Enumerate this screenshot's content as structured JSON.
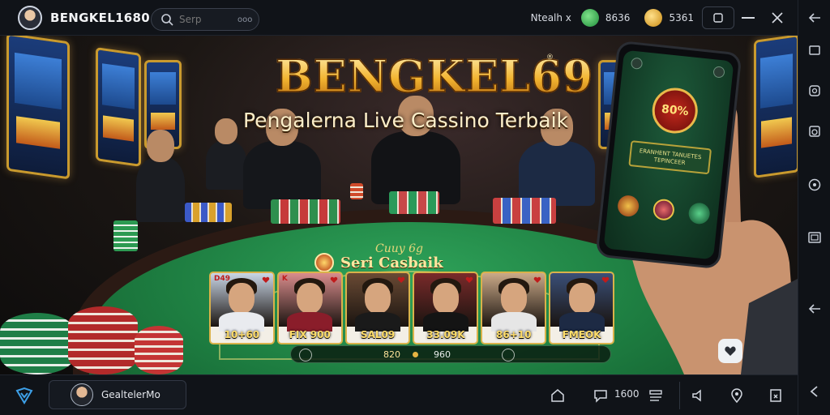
{
  "app": {
    "title": "BENGKEL1680"
  },
  "search": {
    "placeholder": "Serp",
    "badge": "ooo"
  },
  "topbar": {
    "status_label": "Ntealh x",
    "balance_green": "8636",
    "balance_gold": "5361"
  },
  "hero": {
    "brand": "BENGKEL69",
    "trademark": "®",
    "tagline": "Pengalerna Live Cassino Terbaik"
  },
  "table": {
    "felt_logo": "Cuuy 6g",
    "banner": "Seri Casbaik",
    "bet_amount": "820",
    "bet_balance": "960"
  },
  "dealer_cards": [
    {
      "corner": "D49",
      "value": "10+60",
      "shirt": "#e9ebef",
      "bg": "#c9d6e6"
    },
    {
      "corner": "K",
      "value": "FIX 900",
      "shirt": "#8a1d2a",
      "bg": "#d98c8c"
    },
    {
      "corner": "",
      "value": "SAL09",
      "shirt": "#1a1a1a",
      "bg": "#6a4a34"
    },
    {
      "corner": "",
      "value": "33.09K",
      "shirt": "#141414",
      "bg": "#7a2a2a"
    },
    {
      "corner": "",
      "value": "86+10",
      "shirt": "#e6e6e6",
      "bg": "#caa988"
    },
    {
      "corner": "",
      "value": "FMEOK",
      "shirt": "#1d2a44",
      "bg": "#3a4f78"
    }
  ],
  "phone": {
    "badge": "80%",
    "box_text": "ERANHENT TANUETES TEPINCEER"
  },
  "bottombar": {
    "username": "GealtelerMo",
    "counter": "1600"
  },
  "icons": {
    "top": [
      "search-icon",
      "minimize-icon",
      "close-icon"
    ],
    "rail": [
      "back-arrow-icon",
      "square-icon",
      "screenshot-icon",
      "settings-icon",
      "keyboard-icon",
      "fullscreen-icon",
      "back-arrow-icon"
    ],
    "bottom": [
      "app-logo-icon",
      "home-icon",
      "chat-icon",
      "menu-icon",
      "volume-icon",
      "location-icon",
      "exit-icon",
      "collapse-icon"
    ]
  },
  "colors": {
    "felt": "#1d7c40",
    "gold": "#e7b343",
    "background": "#101318"
  }
}
